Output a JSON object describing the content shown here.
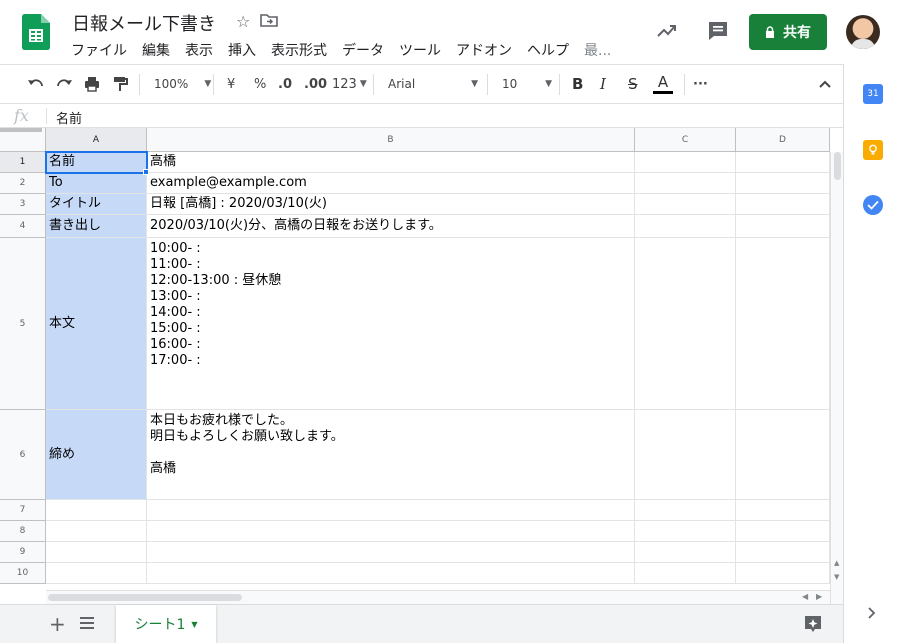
{
  "header": {
    "doc_title": "日報メール下書き",
    "menu": [
      "ファイル",
      "編集",
      "表示",
      "挿入",
      "表示形式",
      "データ",
      "ツール",
      "アドオン",
      "ヘルプ"
    ],
    "menu_more": "最...",
    "share_label": "共有"
  },
  "toolbar": {
    "zoom": "100%",
    "currency": "¥",
    "percent": "%",
    "decimal_decrease": ".0",
    "decimal_increase": ".00",
    "format_number": "123",
    "font": "Arial",
    "font_size": "10",
    "bold": "B",
    "italic": "I",
    "strike": "S",
    "text_color": "A",
    "more": "···"
  },
  "formula_bar": {
    "fx": "fx",
    "value": "名前"
  },
  "columns": [
    "A",
    "B",
    "C",
    "D"
  ],
  "rows": [
    {
      "num": "1",
      "a": "名前",
      "b": "高橋"
    },
    {
      "num": "2",
      "a": "To",
      "b": "example@example.com"
    },
    {
      "num": "3",
      "a": "タイトル",
      "b": "日報 [高橋] : 2020/03/10(火)"
    },
    {
      "num": "4",
      "a": "書き出し",
      "b": "2020/03/10(火)分、高橋の日報をお送りします。"
    },
    {
      "num": "5",
      "a": "本文",
      "b": "10:00- :\n11:00- :\n12:00-13:00 : 昼休憩\n13:00- :\n14:00- :\n15:00- :\n16:00- :\n17:00- :"
    },
    {
      "num": "6",
      "a": "締め",
      "b": "本日もお疲れ様でした。\n明日もよろしくお願い致します。\n\n高橋"
    },
    {
      "num": "7",
      "a": "",
      "b": ""
    },
    {
      "num": "8",
      "a": "",
      "b": ""
    },
    {
      "num": "9",
      "a": "",
      "b": ""
    },
    {
      "num": "10",
      "a": "",
      "b": ""
    }
  ],
  "bottom": {
    "sheet_name": "シート1"
  },
  "side_panel": {
    "calendar_day": "31"
  },
  "colors": {
    "share_green": "#188038",
    "selection_fill": "#c6d9f7",
    "active_border": "#1a73e8"
  }
}
